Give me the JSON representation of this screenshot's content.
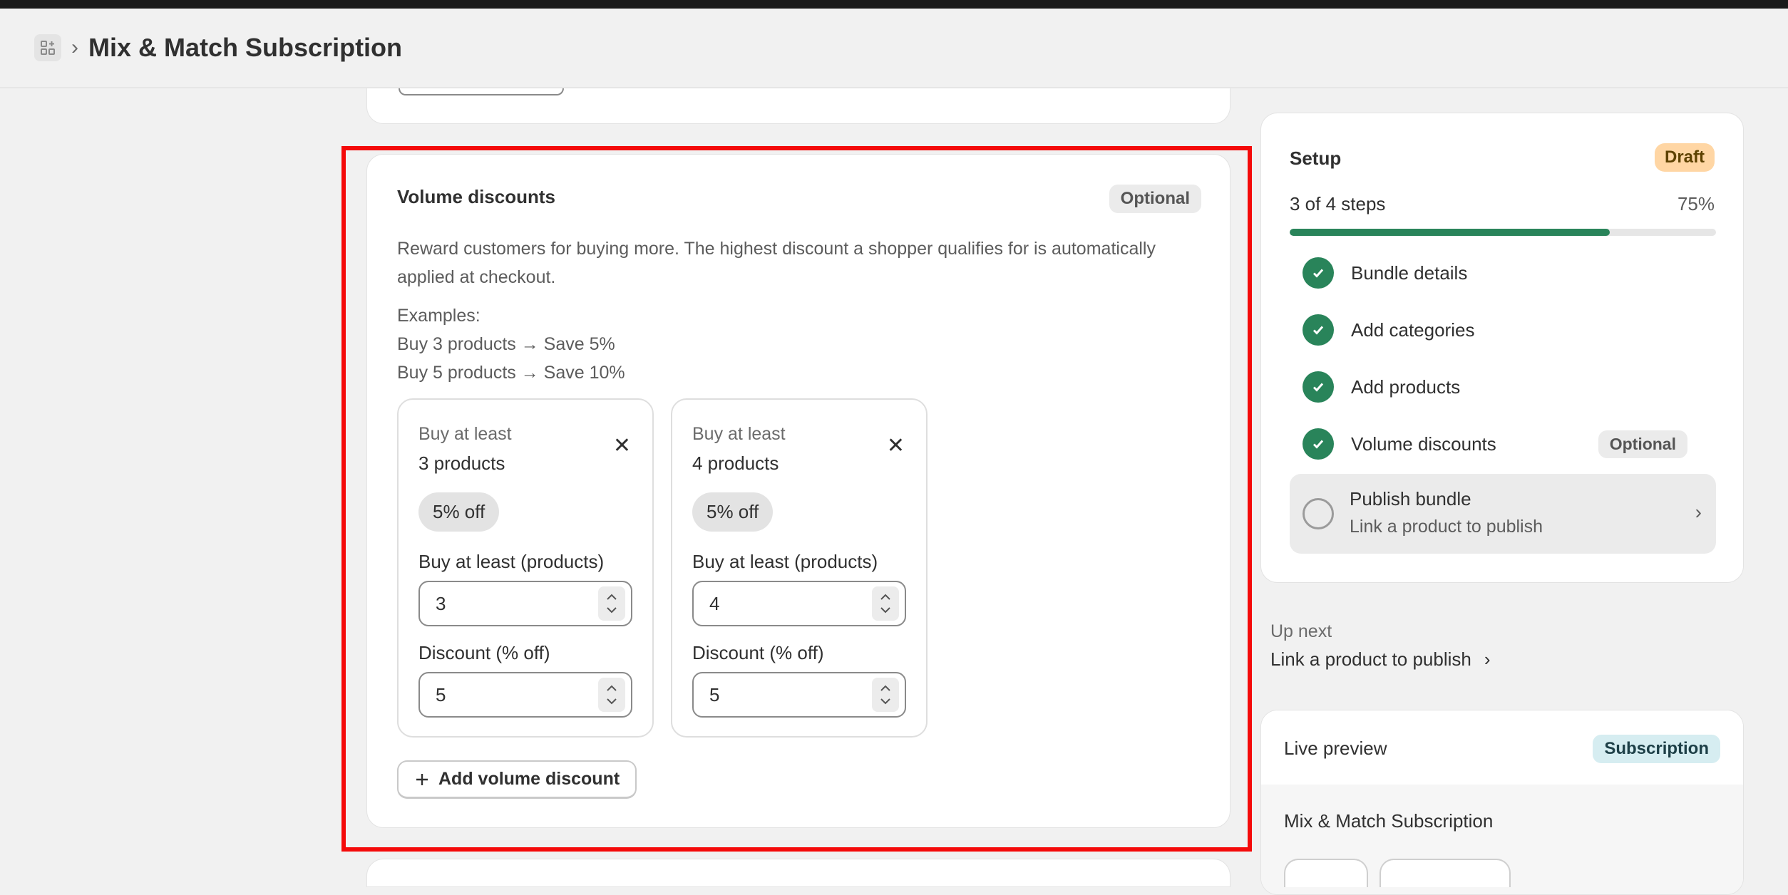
{
  "header": {
    "title": "Mix & Match Subscription",
    "icon": "apps-icon"
  },
  "volume": {
    "title": "Volume discounts",
    "optional_label": "Optional",
    "description": "Reward customers for buying more. The highest discount a shopper qualifies for is automatically applied at checkout.",
    "examples": [
      "Examples:",
      "Buy 3 products → Save 5%",
      "Buy 5 products → Save 10%"
    ],
    "tiers": [
      {
        "label": "Buy at least",
        "count_text": "3 products",
        "badge": "5% off",
        "qty_label": "Buy at least (products)",
        "qty_value": "3",
        "discount_label": "Discount (% off)",
        "discount_value": "5"
      },
      {
        "label": "Buy at least",
        "count_text": "4 products",
        "badge": "5% off",
        "qty_label": "Buy at least (products)",
        "qty_value": "4",
        "discount_label": "Discount (% off)",
        "discount_value": "5"
      }
    ],
    "add_button": "Add volume discount"
  },
  "setup": {
    "title": "Setup",
    "status": "Draft",
    "steps_text": "3 of 4 steps",
    "percent_text": "75%",
    "progress": 0.75,
    "steps": [
      {
        "label": "Bundle details",
        "done": true
      },
      {
        "label": "Add categories",
        "done": true
      },
      {
        "label": "Add products",
        "done": true
      },
      {
        "label": "Volume discounts",
        "done": true,
        "badge": "Optional"
      }
    ],
    "publish": {
      "title": "Publish bundle",
      "subtitle": "Link a product to publish"
    }
  },
  "upnext": {
    "label": "Up next",
    "link": "Link a product to publish"
  },
  "preview": {
    "title": "Live preview",
    "badge": "Subscription",
    "name": "Mix & Match Subscription"
  },
  "colors": {
    "accent_green": "#29845a",
    "highlight_red": "#f40a0a",
    "draft_badge": "#ffd6a4",
    "subscription_badge": "#d6edf1"
  }
}
